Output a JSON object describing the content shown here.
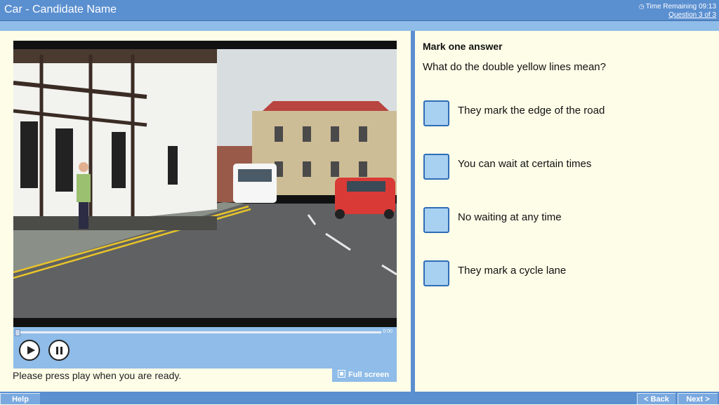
{
  "header": {
    "title": "Car - Candidate Name",
    "time_remaining": "Time Remaining 09:13",
    "question_count": "Question 3 of 3"
  },
  "video": {
    "timecode": "0:00",
    "status_text": "Please press play when you are ready.",
    "fullscreen_label": "Full screen",
    "progress": 0
  },
  "question": {
    "instruction": "Mark one answer",
    "text": "What do the double yellow lines mean?",
    "answers": [
      {
        "label": "They mark the edge of the road"
      },
      {
        "label": "You can wait at certain times"
      },
      {
        "label": "No waiting at any time"
      },
      {
        "label": "They mark a cycle lane"
      }
    ]
  },
  "footer": {
    "help_label": "Help",
    "back_label": "< Back",
    "next_label": "Next >"
  },
  "colors": {
    "bar": "#5a8fd0",
    "light_bar": "#8fbce8",
    "background": "#fdfde8",
    "answer_box": "#a8d0f0"
  },
  "icons": {
    "clock": "clock-icon",
    "play": "play-icon",
    "pause": "pause-icon",
    "fullscreen": "fullscreen-icon"
  }
}
